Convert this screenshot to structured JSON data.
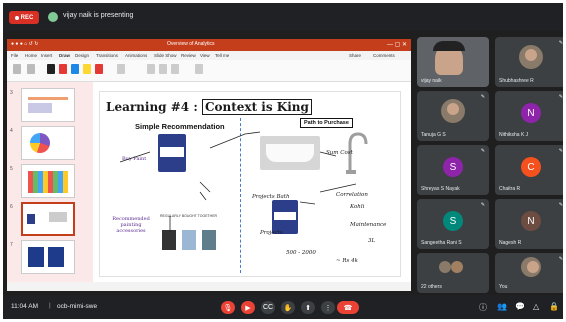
{
  "topbar": {
    "rec_label": "REC",
    "presenting_text": "vijay naik is presenting"
  },
  "ppt": {
    "window_title": "Overview of Analytics",
    "tabs": [
      "File",
      "Home",
      "Insert",
      "Draw",
      "Design",
      "Transitions",
      "Animations",
      "Slide Show",
      "Review",
      "View",
      "Tell me"
    ],
    "share_label": "Share",
    "comments_label": "Comments",
    "thumb_numbers": [
      "3",
      "4",
      "5",
      "6",
      "7"
    ]
  },
  "slide": {
    "title_prefix": "Learning #4 :",
    "title_boxed": "Context is King",
    "subtitle_left": "Simple Recommendation",
    "subtitle_right": "Path to Purchase",
    "buy_paint": "Buy Paint",
    "recommended": "Recommended painting accessories",
    "rat": "REGULARLY BOUGHT TOGETHER",
    "handwriting": {
      "projects_bath": "Projects Bath",
      "projects": "Projects",
      "sum_cost": "Sum Cost",
      "correlation": "Correlation",
      "kohli": "Kohli",
      "maintenance": "Maintenance",
      "price_range": "500 - 2000",
      "size": "3L",
      "rs": "~ Rs 4k"
    }
  },
  "participants": [
    {
      "name": "vijay naik",
      "type": "photo",
      "color": "#5f6368"
    },
    {
      "name": "Shubhashree R",
      "type": "photo",
      "color": "#6b5a4e"
    },
    {
      "name": "Tanuja G S",
      "type": "photo",
      "color": "#6b5a4e"
    },
    {
      "name": "Nithiksha K J",
      "type": "letter",
      "letter": "N",
      "color": "#8e24aa"
    },
    {
      "name": "Shreyas S Nayak",
      "type": "letter",
      "letter": "S",
      "color": "#8e24aa"
    },
    {
      "name": "Chaitra R",
      "type": "letter",
      "letter": "C",
      "color": "#f4511e"
    },
    {
      "name": "Sangeetha Rani S",
      "type": "letter",
      "letter": "S",
      "color": "#00897b"
    },
    {
      "name": "Nagesh R",
      "type": "letter",
      "letter": "N",
      "color": "#6d4c41"
    },
    {
      "name": "22 others",
      "type": "group",
      "color": "#5f6368"
    },
    {
      "name": "You",
      "type": "photo",
      "color": "#6b5a4e"
    }
  ],
  "bottombar": {
    "time": "11:04 AM",
    "separator": "|",
    "meeting_code": "ocb-mimi-swe"
  },
  "colors": {
    "accent_red": "#ea4335",
    "ppt_orange": "#c43e1c",
    "meet_dark": "#202124"
  }
}
